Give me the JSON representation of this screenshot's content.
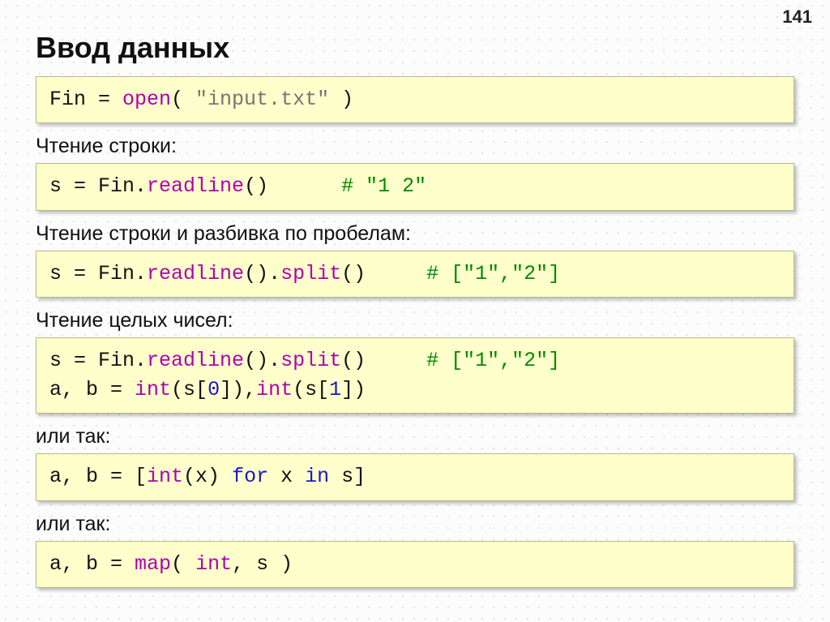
{
  "page_number": "141",
  "title": "Ввод данных",
  "code1": {
    "l1a": "Fin = ",
    "l1b": "open",
    "l1c": "( ",
    "l1d": "\"input.txt\"",
    "l1e": " )"
  },
  "sub1": "Чтение строки:",
  "code2": {
    "l1a": "s = Fin.",
    "l1b": "readline",
    "l1c": "()      ",
    "l1d": "# \"1 2\""
  },
  "sub2": "Чтение строки и разбивка по пробелам:",
  "code3": {
    "l1a": "s = Fin.",
    "l1b": "readline",
    "l1c": "().",
    "l1d": "split",
    "l1e": "()     ",
    "l1f": "# [\"1\",\"2\"]"
  },
  "sub3": "Чтение целых чисел:",
  "code4": {
    "l1a": "s = Fin.",
    "l1b": "readline",
    "l1c": "().",
    "l1d": "split",
    "l1e": "()     ",
    "l1f": "# [\"1\",\"2\"]",
    "l2a": "a, b = ",
    "l2b": "int",
    "l2c": "(s[",
    "l2d": "0",
    "l2e": "]),",
    "l2f": "int",
    "l2g": "(s[",
    "l2h": "1",
    "l2i": "])"
  },
  "sub4": "или так:",
  "code5": {
    "l1a": "a, b = [",
    "l1b": "int",
    "l1c": "(x) ",
    "l1d": "for",
    "l1e": " x ",
    "l1f": "in",
    "l1g": " s]"
  },
  "sub5": "или так:",
  "code6": {
    "l1a": "a, b = ",
    "l1b": "map",
    "l1c": "( ",
    "l1d": "int",
    "l1e": ", s )"
  }
}
